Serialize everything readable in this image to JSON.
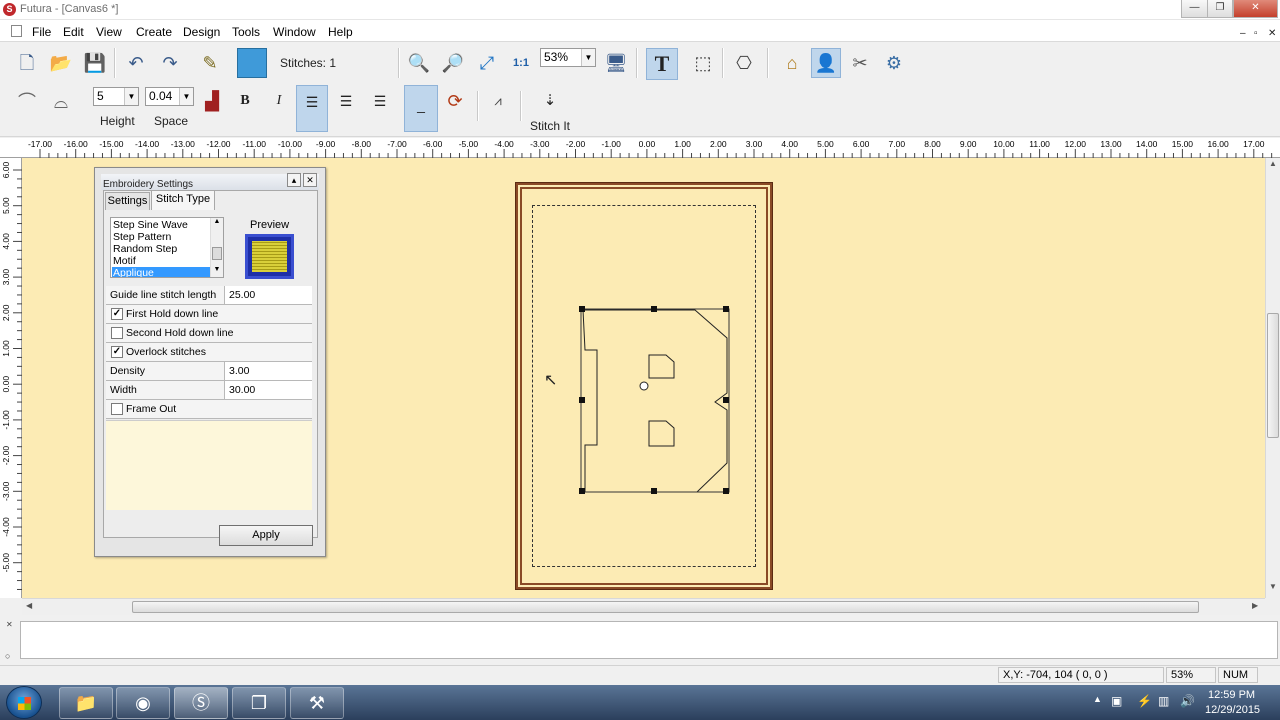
{
  "window": {
    "title": "Futura - [Canvas6 *]",
    "controls": [
      "—",
      "❐",
      "✕"
    ],
    "mdi_controls": [
      "–",
      "▫",
      "✕"
    ]
  },
  "menu": [
    "File",
    "Edit",
    "View",
    "Create",
    "Design",
    "Tools",
    "Window",
    "Help"
  ],
  "toolbar": {
    "stitches_label": "Stitches: 1",
    "zoom_value": "53%",
    "font_size_value": "5",
    "spacing_value": "0.04",
    "height_label": "Height",
    "space_label": "Space",
    "stitch_it_label": "Stitch It",
    "bold_label": "B",
    "italic_label": "I"
  },
  "ruler": {
    "h_ticks": [
      "-17.00",
      "-16.00",
      "-15.00",
      "-14.00",
      "-13.00",
      "-12.00",
      "-11.00",
      "-10.00",
      "-9.00",
      "-8.00",
      "-7.00",
      "-6.00",
      "-5.00",
      "-4.00",
      "-3.00",
      "-2.00",
      "-1.00",
      "0.00",
      "1.00",
      "2.00",
      "3.00",
      "4.00",
      "5.00",
      "6.00",
      "7.00",
      "8.00",
      "9.00",
      "10.00",
      "11.00",
      "12.00",
      "13.00",
      "14.00",
      "15.00",
      "16.00",
      "17.00"
    ],
    "v_ticks": [
      "6.00",
      "5.00",
      "4.00",
      "3.00",
      "2.00",
      "1.00",
      "0.00",
      "-1.00",
      "-2.00",
      "-3.00",
      "-4.00",
      "-5.00"
    ]
  },
  "dialog": {
    "title": "Embroidery Settings",
    "tabs": [
      "Settings",
      "Stitch Type"
    ],
    "stitch_types": [
      "Step Sine Wave",
      "Step Pattern",
      "Random Step",
      "Motif",
      "Applique"
    ],
    "selected_stitch_type": "Applique",
    "preview_label": "Preview",
    "props": {
      "guide_label": "Guide line stitch length",
      "guide_value": "25.00",
      "first_hold": "First Hold down line",
      "first_hold_checked": true,
      "second_hold": "Second Hold down line",
      "second_hold_checked": false,
      "overlock": "Overlock stitches",
      "overlock_checked": true,
      "density_label": "Density",
      "density_value": "3.00",
      "width_label": "Width",
      "width_value": "30.00",
      "frame_out": "Frame Out",
      "frame_out_checked": false
    },
    "apply_label": "Apply"
  },
  "status": {
    "xy": "X,Y: -704, 104  ( 0, 0 )",
    "zoom": "53%",
    "num": "NUM"
  },
  "taskbar": {
    "time": "12:59 PM",
    "date": "12/29/2015"
  },
  "colors": {
    "canvas": "#fcebb4",
    "hoop": "#8a4a26",
    "selection": "#3399ff"
  }
}
